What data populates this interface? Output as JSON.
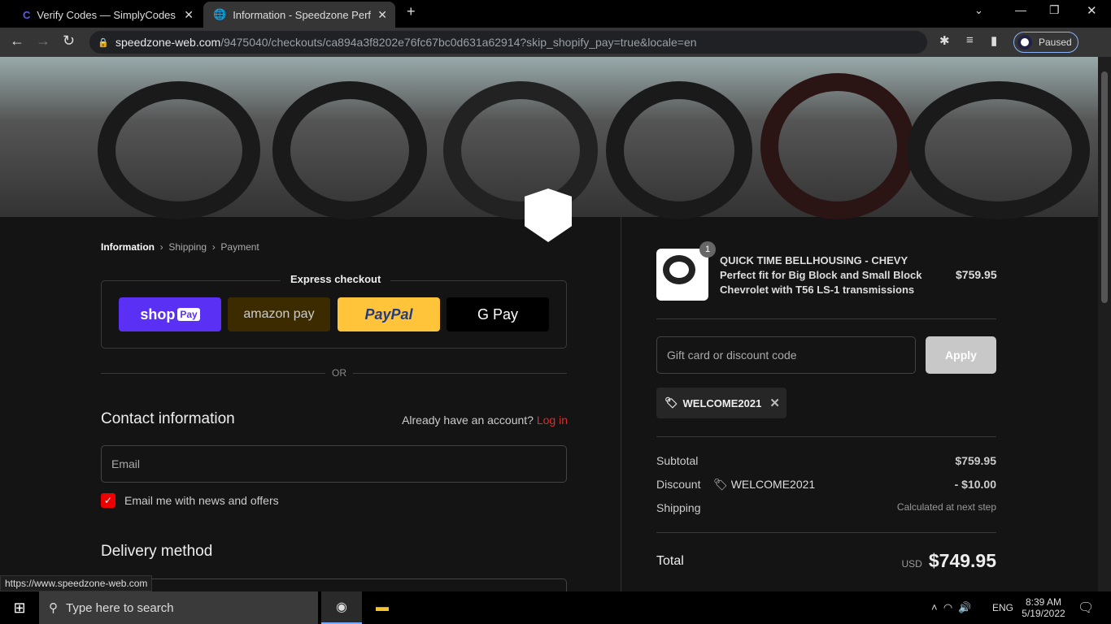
{
  "browser": {
    "tabs": [
      {
        "title": "Verify Codes — SimplyCodes"
      },
      {
        "title": "Information - Speedzone Perform"
      }
    ],
    "url_domain": "speedzone-web.com",
    "url_path": "/9475040/checkouts/ca894a3f8202e76fc67bc0d631a62914?skip_shopify_pay=true&locale=en",
    "profile_status": "Paused"
  },
  "breadcrumb": [
    "Information",
    "Shipping",
    "Payment"
  ],
  "express": {
    "title": "Express checkout",
    "buttons": [
      {
        "label": "shop",
        "badge": "Pay"
      },
      {
        "label": "amazon pay"
      },
      {
        "label": "PayPal"
      },
      {
        "label": "G Pay"
      }
    ],
    "or": "OR"
  },
  "contact": {
    "title": "Contact information",
    "account_prompt": "Already have an account?",
    "login": "Log in",
    "email_placeholder": "Email",
    "newsletter_label": "Email me with news and offers",
    "newsletter_checked": true
  },
  "delivery": {
    "title": "Delivery method"
  },
  "order": {
    "item": {
      "qty": "1",
      "name": "QUICK TIME BELLHOUSING - CHEVY",
      "desc": "Perfect fit for Big Block and Small Block Chevrolet with T56 LS-1 transmissions",
      "price": "$759.95"
    },
    "discount_placeholder": "Gift card or discount code",
    "apply": "Apply",
    "code": "WELCOME2021",
    "subtotal_label": "Subtotal",
    "subtotal": "$759.95",
    "discount_label": "Discount",
    "discount": "- $10.00",
    "shipping_label": "Shipping",
    "shipping": "Calculated at next step",
    "total_label": "Total",
    "currency": "USD",
    "total": "$749.95"
  },
  "status_url": "https://www.speedzone-web.com",
  "taskbar": {
    "search_placeholder": "Type here to search",
    "lang": "ENG",
    "time": "8:39 AM",
    "date": "5/19/2022"
  }
}
